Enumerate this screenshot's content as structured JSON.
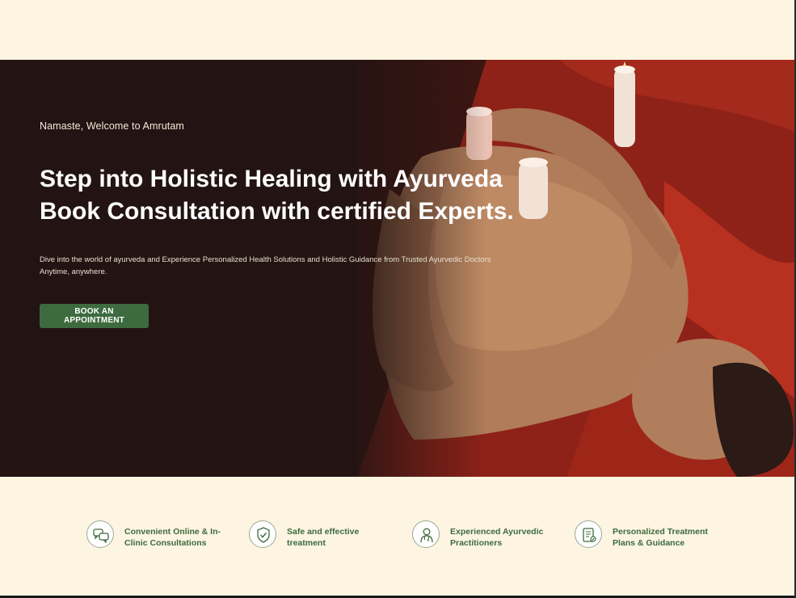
{
  "hero": {
    "greeting": "Namaste, Welcome to Amrutam",
    "headline_line1": "Step into Holistic Healing with Ayurveda",
    "headline_line2": "Book Consultation with certified Experts.",
    "description": "Dive into the world of ayurveda and Experience Personalized Health Solutions and Holistic Guidance from Trusted Ayurvedic Doctors Anytime, anywhere.",
    "cta_label": "BOOK AN APPOINTMENT"
  },
  "features": [
    {
      "icon": "chat-bubbles-icon",
      "label": "Convenient Online & In-Clinic Consultations"
    },
    {
      "icon": "shield-check-icon",
      "label": "Safe and effective treatment"
    },
    {
      "icon": "doctor-icon",
      "label": "Experienced Ayurvedic Practitioners"
    },
    {
      "icon": "clipboard-plan-icon",
      "label": "Personalized Treatment Plans & Guidance"
    }
  ],
  "colors": {
    "page_bg": "#fdf5e1",
    "hero_bg": "#231413",
    "accent_green": "#3d6b3f"
  }
}
